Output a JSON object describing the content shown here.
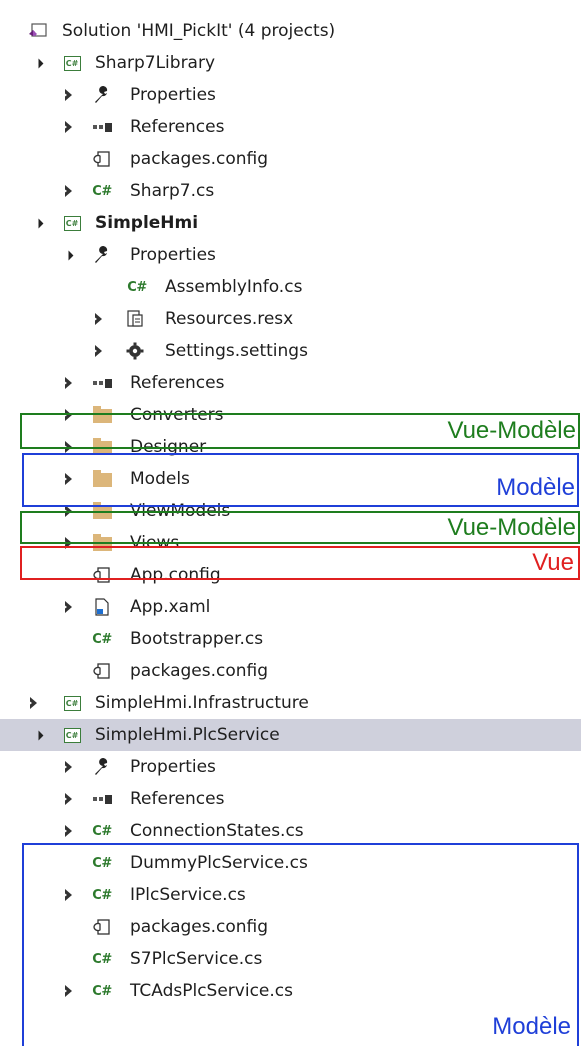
{
  "solution": {
    "label": "Solution 'HMI_PickIt' (4 projects)",
    "icon": "visual-studio-solution-icon"
  },
  "rows": [
    {
      "label": "Sharp7Library",
      "icon": "csharp-project-icon"
    },
    {
      "label": "Properties",
      "icon": "wrench-icon"
    },
    {
      "label": "References",
      "icon": "references-icon"
    },
    {
      "label": "packages.config",
      "icon": "config-file-icon"
    },
    {
      "label": "Sharp7.cs",
      "icon": "csharp-file-icon"
    },
    {
      "label": "SimpleHmi",
      "icon": "csharp-project-icon"
    },
    {
      "label": "Properties",
      "icon": "wrench-icon"
    },
    {
      "label": "AssemblyInfo.cs",
      "icon": "csharp-file-icon"
    },
    {
      "label": "Resources.resx",
      "icon": "resource-file-icon"
    },
    {
      "label": "Settings.settings",
      "icon": "settings-gear-icon"
    },
    {
      "label": "References",
      "icon": "references-icon"
    },
    {
      "label": "Converters",
      "icon": "folder-icon"
    },
    {
      "label": "Designer",
      "icon": "folder-icon"
    },
    {
      "label": "Models",
      "icon": "folder-icon"
    },
    {
      "label": "ViewModels",
      "icon": "folder-icon"
    },
    {
      "label": "Views",
      "icon": "folder-icon"
    },
    {
      "label": "App.config",
      "icon": "config-file-icon"
    },
    {
      "label": "App.xaml",
      "icon": "xaml-file-icon"
    },
    {
      "label": "Bootstrapper.cs",
      "icon": "csharp-file-icon"
    },
    {
      "label": "packages.config",
      "icon": "config-file-icon"
    },
    {
      "label": "SimpleHmi.Infrastructure",
      "icon": "csharp-project-icon"
    },
    {
      "label": "SimpleHmi.PlcService",
      "icon": "csharp-project-icon"
    },
    {
      "label": "Properties",
      "icon": "wrench-icon"
    },
    {
      "label": "References",
      "icon": "references-icon"
    },
    {
      "label": "ConnectionStates.cs",
      "icon": "csharp-file-icon"
    },
    {
      "label": "DummyPlcService.cs",
      "icon": "csharp-file-icon"
    },
    {
      "label": "IPlcService.cs",
      "icon": "csharp-file-icon"
    },
    {
      "label": "packages.config",
      "icon": "config-file-icon"
    },
    {
      "label": "S7PlcService.cs",
      "icon": "csharp-file-icon"
    },
    {
      "label": "TCAdsPlcService.cs",
      "icon": "csharp-file-icon"
    }
  ],
  "annotations": [
    {
      "text": "Vue-Modèle",
      "color": "#1e7d1e"
    },
    {
      "text": "Modèle",
      "color": "#1f3fd8"
    },
    {
      "text": "Vue-Modèle",
      "color": "#1e7d1e"
    },
    {
      "text": "Vue",
      "color": "#e02020"
    },
    {
      "text": "Modèle",
      "color": "#1f3fd8"
    }
  ],
  "colors": {
    "selection": "#cfd0dc",
    "csharp": "#2d7a2d",
    "folder": "#dcb67a"
  }
}
